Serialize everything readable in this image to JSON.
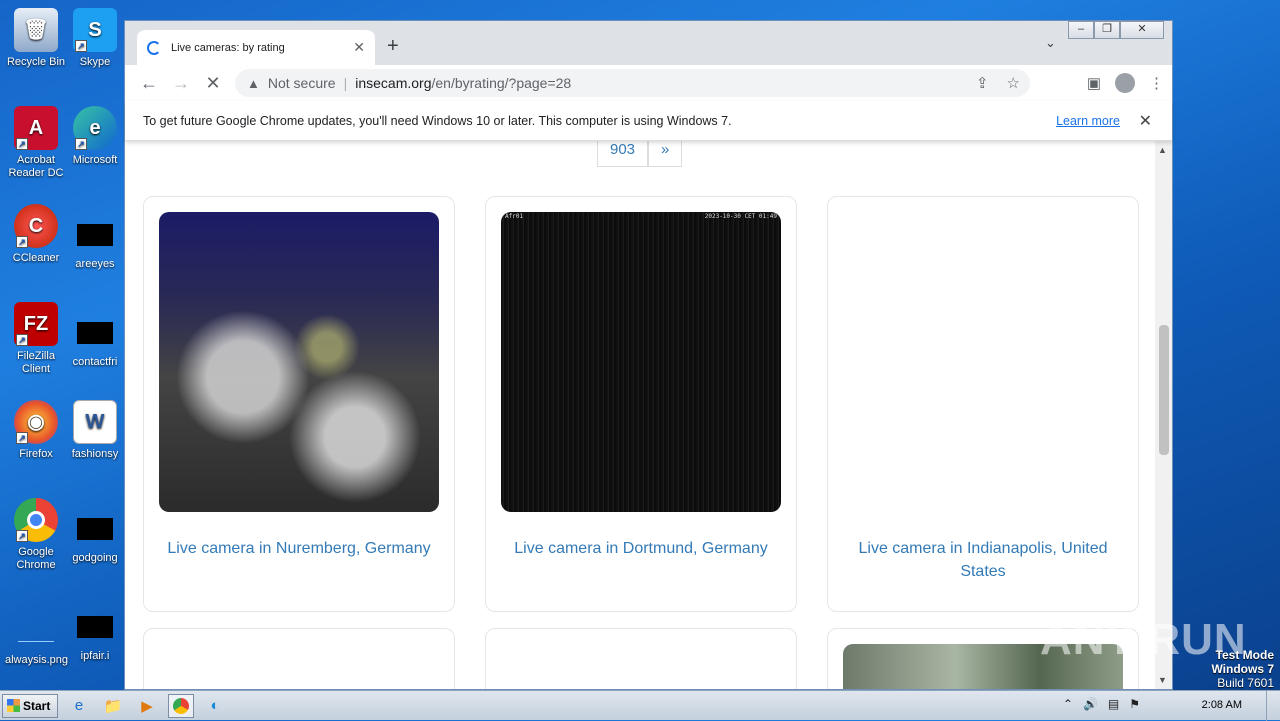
{
  "desktop": {
    "icons": [
      {
        "label": "Recycle Bin"
      },
      {
        "label": "Skype"
      },
      {
        "label": "Acrobat Reader DC"
      },
      {
        "label": "Microsoft"
      },
      {
        "label": "CCleaner"
      },
      {
        "label": "areeyes"
      },
      {
        "label": "FileZilla Client"
      },
      {
        "label": "contactfri"
      },
      {
        "label": "Firefox"
      },
      {
        "label": "fashionsy"
      },
      {
        "label": "Google Chrome"
      },
      {
        "label": "godgoing"
      },
      {
        "label": "alwaysis.png"
      },
      {
        "label": "ipfair.i"
      }
    ]
  },
  "browser": {
    "tab_title": "Live cameras: by rating",
    "url_security": "Not secure",
    "url_host": "insecam.org",
    "url_path": "/en/byrating/?page=28",
    "window_controls": {
      "minimize": "–",
      "restore": "❐",
      "close": "✕"
    }
  },
  "infobar": {
    "message": "To get future Google Chrome updates, you'll need Windows 10 or later. This computer is using Windows 7.",
    "link": "Learn more"
  },
  "page": {
    "pager": [
      "903",
      "»"
    ],
    "cameras": [
      {
        "caption": "Live camera in Nuremberg, Germany"
      },
      {
        "caption": "Live camera in Dortmund, Germany",
        "overlay_left": "Afr01",
        "overlay_right": "2023-10-30 CET 01:49"
      },
      {
        "caption": "Live camera in Indianapolis, United States"
      }
    ]
  },
  "watermark": "ANY RUN",
  "os": {
    "start_label": "Start",
    "clock": "2:08 AM",
    "testmode_line1": "Test Mode",
    "testmode_line2": "Windows 7",
    "testmode_line3": "Build 7601"
  }
}
